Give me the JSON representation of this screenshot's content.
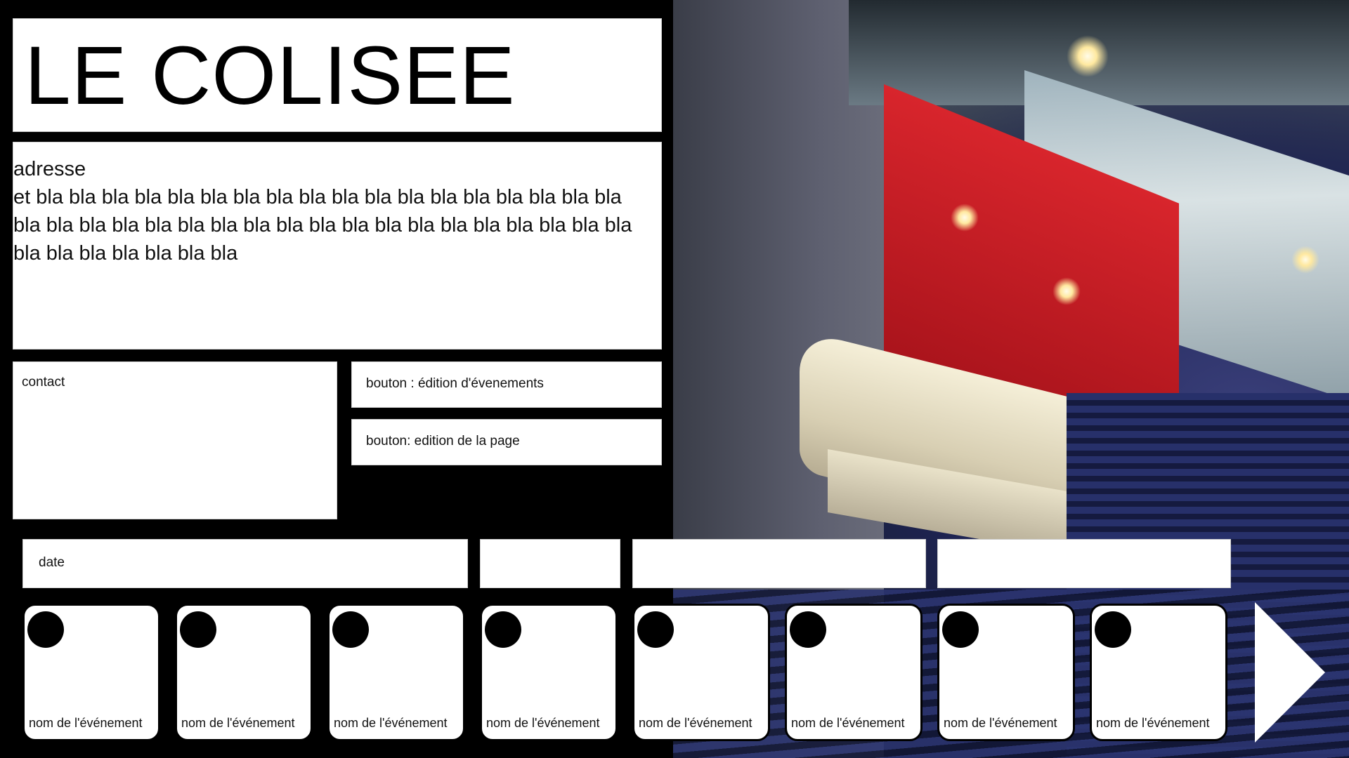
{
  "venue": {
    "title": "LE COLISEE",
    "address_label": "adresse",
    "description_lines": [
      "et bla bla bla bla bla bla bla bla bla bla bla bla bla bla bla bla bla bla",
      "bla bla bla bla bla bla bla bla bla bla bla bla bla bla bla bla bla bla bla",
      "bla bla bla bla bla bla bla"
    ]
  },
  "contact": {
    "label": "contact"
  },
  "buttons": {
    "edit_events": "bouton : édition d'évenements",
    "edit_page": "bouton: edition de la page"
  },
  "tabs": {
    "date_label": "date"
  },
  "events": [
    {
      "name": "nom de l'événement"
    },
    {
      "name": "nom de l'événement"
    },
    {
      "name": "nom de l'événement"
    },
    {
      "name": "nom de l'événement"
    },
    {
      "name": "nom de l'événement"
    },
    {
      "name": "nom de l'événement"
    },
    {
      "name": "nom de l'événement"
    },
    {
      "name": "nom de l'événement"
    }
  ],
  "icons": {
    "next": "triangle-right-icon",
    "event_marker": "circle-icon"
  },
  "colors": {
    "panel": "#000000",
    "box": "#ffffff",
    "text": "#111111"
  }
}
